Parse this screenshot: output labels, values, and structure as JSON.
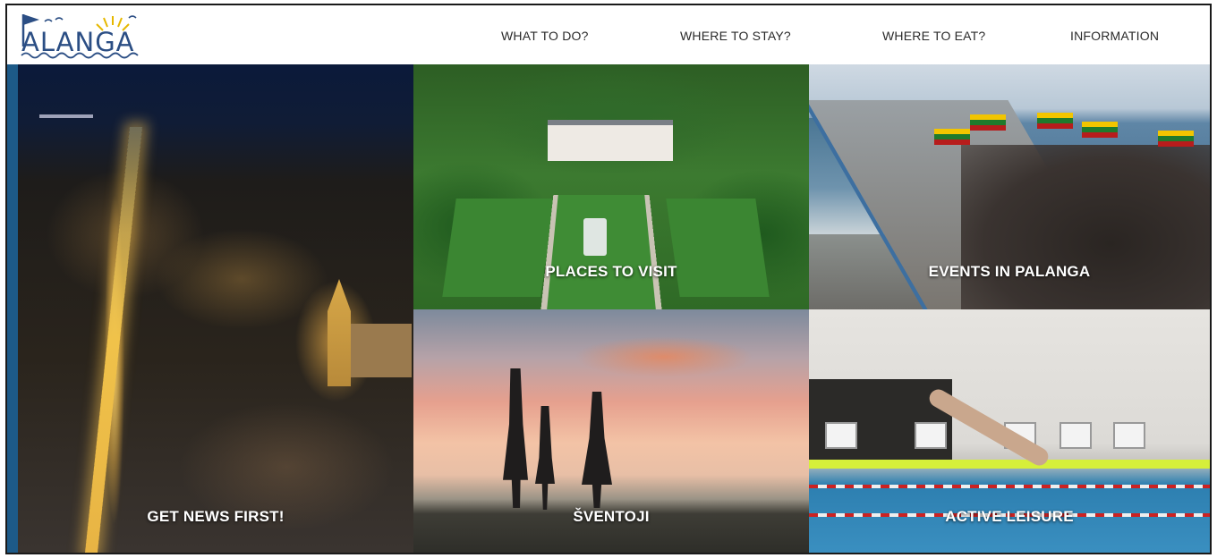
{
  "brand": {
    "logo_text": "ALANGA",
    "logo_letter": "P"
  },
  "nav": {
    "items": [
      "WHAT TO DO?",
      "WHERE TO STAY?",
      "WHERE TO EAT?",
      "INFORMATION"
    ]
  },
  "tiles": {
    "news": "GET NEWS FIRST!",
    "places": "PLACES TO VISIT",
    "events": "EVENTS IN PALANGA",
    "sventoji": "ŠVENTOJI",
    "leisure": "ACTIVE LEISURE"
  },
  "colors": {
    "brand_blue": "#2b4e84",
    "content_background": "#1d5a88",
    "tile_label": "#ffffff"
  }
}
